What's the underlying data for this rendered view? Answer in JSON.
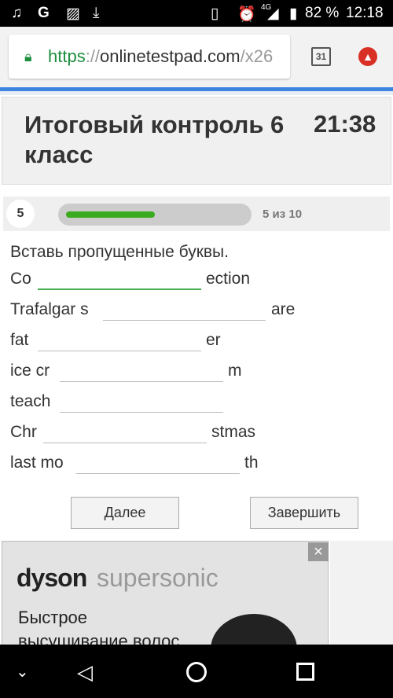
{
  "status_bar": {
    "battery": "82 %",
    "time": "12:18",
    "network": "4G"
  },
  "browser": {
    "url_scheme": "https",
    "url_sep": "://",
    "url_host": "onlinetestpad.com",
    "url_path": "/x26",
    "tab_count": "31"
  },
  "test": {
    "title": "Итоговый контроль 6 класс",
    "timer": "21:38"
  },
  "progress": {
    "question_number": "5",
    "label": "5 из 10",
    "fraction": 0.5,
    "accent": "#3aaa1e"
  },
  "question": {
    "prompt": "Вставь пропущенные буквы.",
    "rows": [
      {
        "before": "Co",
        "after": "ection",
        "value": ""
      },
      {
        "before": "Trafalgar s",
        "after": "are",
        "value": ""
      },
      {
        "before": "fat",
        "after": "er",
        "value": ""
      },
      {
        "before": "ice cr",
        "after": "m",
        "value": ""
      },
      {
        "before": "teach",
        "after": "",
        "value": ""
      },
      {
        "before": "Chr",
        "after": "stmas",
        "value": ""
      },
      {
        "before": "last mo",
        "after": "th",
        "value": ""
      }
    ]
  },
  "buttons": {
    "next": "Далее",
    "finish": "Завершить"
  },
  "ad": {
    "brand": "dyson",
    "product": "supersonic",
    "text_line1": "Быстрое",
    "text_line2": "высушивание волос,",
    "close": "×"
  }
}
